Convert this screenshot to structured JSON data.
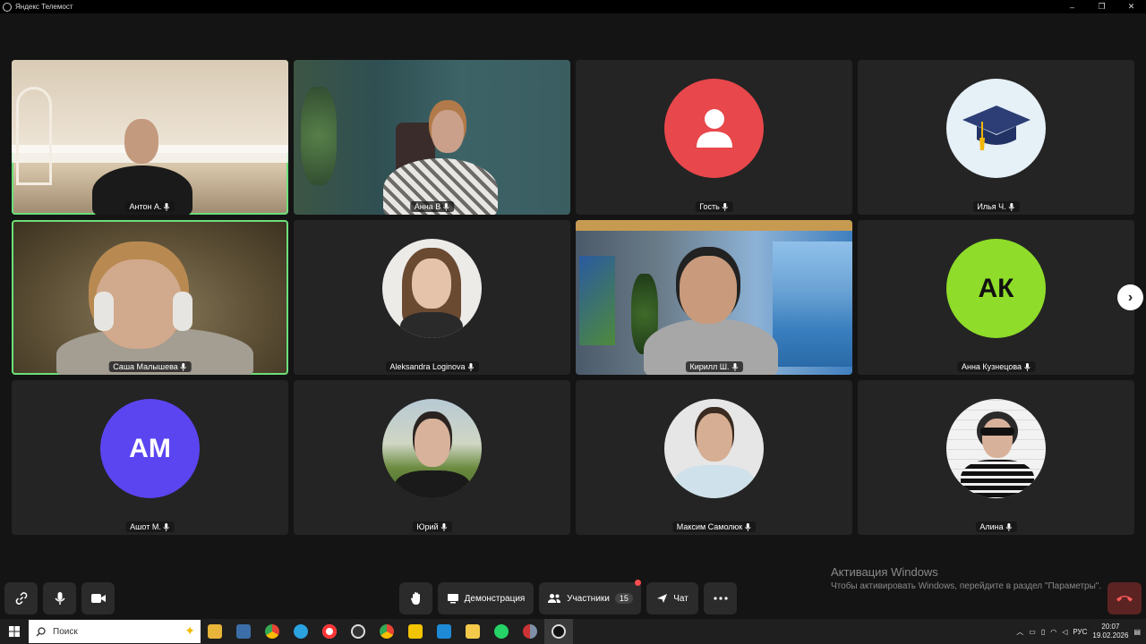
{
  "window": {
    "title": "Яндекс Телемост",
    "minimize": "–",
    "restore": "❐",
    "close": "✕"
  },
  "participants": [
    {
      "name": "Антон А.",
      "type": "video",
      "speaking": true
    },
    {
      "name": "Анна В",
      "type": "video",
      "speaking": false
    },
    {
      "name": "Гость",
      "type": "avatar",
      "avatar_color": "#e8474b",
      "initials": ""
    },
    {
      "name": "Илья Ч.",
      "type": "avatar",
      "avatar_color": "#e6f0f7",
      "initials": ""
    },
    {
      "name": "Саша Малышева",
      "type": "video",
      "speaking": true
    },
    {
      "name": "Aleksandra Loginova",
      "type": "photo"
    },
    {
      "name": "Кирилл Ш.",
      "type": "video",
      "speaking": false
    },
    {
      "name": "Анна Кузнецова",
      "type": "avatar",
      "avatar_color": "#8fdc2a",
      "initials": "АК"
    },
    {
      "name": "Ашот М.",
      "type": "avatar",
      "avatar_color": "#5b45f0",
      "initials": "АМ"
    },
    {
      "name": "Юрий",
      "type": "photo"
    },
    {
      "name": "Максим Самолюк",
      "type": "photo"
    },
    {
      "name": "Алина",
      "type": "photo"
    }
  ],
  "next_page": "›",
  "activation": {
    "title": "Активация Windows",
    "subtitle": "Чтобы активировать Windows, перейдите в раздел \"Параметры\"."
  },
  "controls": {
    "screen_share": "Демонстрация",
    "participants": "Участники",
    "participants_count": "15",
    "chat": "Чат"
  },
  "taskbar": {
    "search_placeholder": "Поиск",
    "language": "РУС",
    "time": "20:07",
    "date": "19.02.2026"
  },
  "colors": {
    "speaking": "#6be07a",
    "background": "#141414",
    "tile": "#242424",
    "hangup": "#5c2323"
  }
}
